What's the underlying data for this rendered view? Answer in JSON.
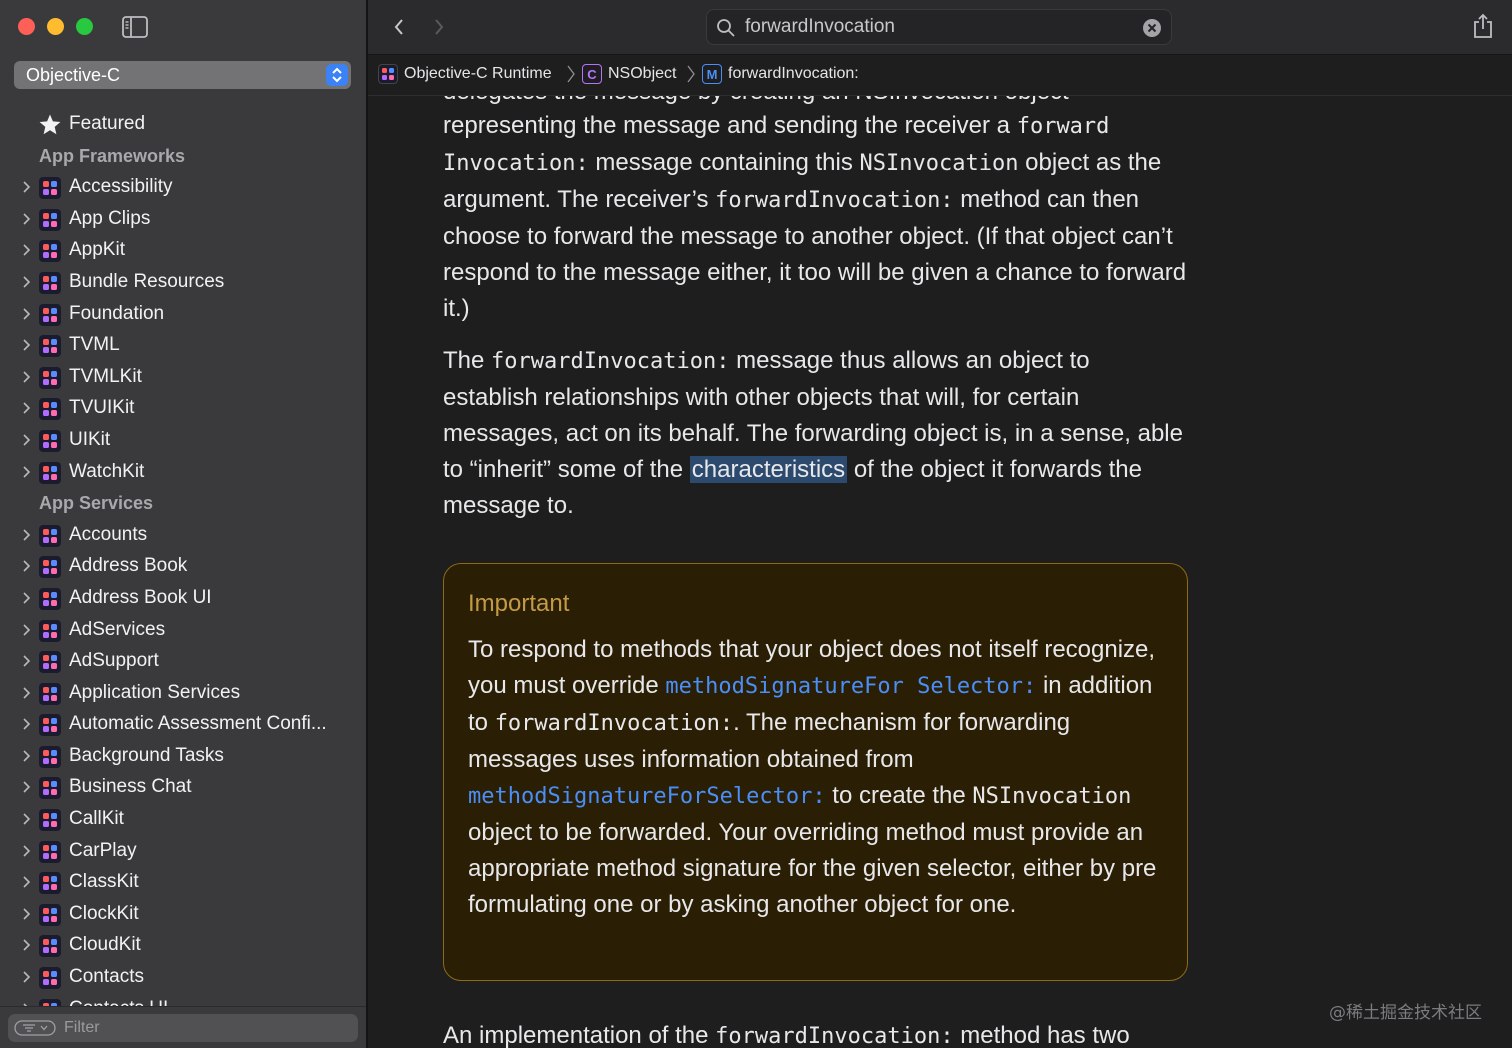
{
  "window": {
    "title": "forwardInvocation"
  },
  "sidebar": {
    "language": "Objective-C",
    "featured_label": "Featured",
    "section_app_frameworks": "App Frameworks",
    "app_frameworks": [
      "Accessibility",
      "App Clips",
      "AppKit",
      "Bundle Resources",
      "Foundation",
      "TVML",
      "TVMLKit",
      "TVUIKit",
      "UIKit",
      "WatchKit"
    ],
    "section_app_services": "App Services",
    "app_services": [
      "Accounts",
      "Address Book",
      "Address Book UI",
      "AdServices",
      "AdSupport",
      "Application Services",
      "Automatic Assessment Confi...",
      "Background Tasks",
      "Business Chat",
      "CallKit",
      "CarPlay",
      "ClassKit",
      "ClockKit",
      "CloudKit",
      "Contacts",
      "Contacts UI"
    ],
    "filter_placeholder": "Filter"
  },
  "toolbar": {
    "search_value": "forwardInvocation"
  },
  "breadcrumb": [
    {
      "icon": "framework-icon",
      "label": "Objective-C Runtime"
    },
    {
      "icon": "class-icon",
      "badge": "C",
      "label": "NSObject"
    },
    {
      "icon": "method-icon",
      "badge": "M",
      "label": "forwardInvocation:"
    }
  ],
  "content": {
    "clipped_line": "delegates the message by creating an NSInvocation object",
    "p1": {
      "t1": "representing the message and sending the receiver a ",
      "code1": "forward Invocation:",
      "t2": " message containing this ",
      "code2": "NSInvocation",
      "t3": " object as the argument. The receiver’s ",
      "code3": "forwardInvocation:",
      "t4": " method can then choose to forward the message to another object. (If that object can’t respond to the message either, it too will be given a chance to forward it.)"
    },
    "p2": {
      "t1": "The ",
      "code1": "forwardInvocation:",
      "t2": " message thus allows an object to establish relationships with other objects that will, for certain messages, act on its behalf. The forwarding object is, in a sense, able to “inherit” some of the ",
      "highlight": "characteristics",
      "t3": " of the object it forwards the message to."
    },
    "callout": {
      "title": "Important",
      "t1": "To respond to methods that your object does not itself recognize, you must override ",
      "link1": "methodSignatureFor Selector:",
      "t2": " in addition to ",
      "code1": "forwardInvocation:",
      "t3": ". The mechanism for forwarding messages uses information obtained from ",
      "link2": "methodSignatureForSelector:",
      "t4": " to create the ",
      "code2": "NSInvocation",
      "t5": " object to be forwarded. Your overriding method must provide an appropriate method signature for the given selector, either by pre formulating one or by asking another object for one."
    },
    "p3": {
      "t1": "An implementation of the ",
      "code1": "forwardInvocation:",
      "t2": " method has two"
    }
  },
  "watermark": "@稀土掘金技术社区",
  "colors": {
    "accent": "#4a8ef7",
    "callout_border": "#8d6a14",
    "callout_title": "#c49a45"
  }
}
